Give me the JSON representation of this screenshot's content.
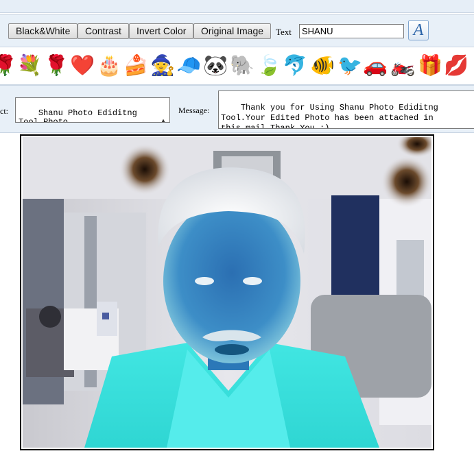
{
  "toolbar": {
    "black_white_label": "Black&White",
    "contrast_label": "Contrast",
    "invert_label": "Invert Color",
    "original_label": "Original Image",
    "text_label": "Text",
    "text_value": "SHANU",
    "font_button_glyph": "A"
  },
  "stickers": [
    {
      "name": "rose-icon",
      "glyph": "🌹"
    },
    {
      "name": "flower-bouquet-icon",
      "glyph": "💐"
    },
    {
      "name": "red-rose-icon",
      "glyph": "🌹"
    },
    {
      "name": "heart-icon",
      "glyph": "❤️"
    },
    {
      "name": "birthday-cake-icon",
      "glyph": "🎂"
    },
    {
      "name": "cake-icon",
      "glyph": "🍰"
    },
    {
      "name": "wizard-hat-icon",
      "glyph": "🧙"
    },
    {
      "name": "cap-icon",
      "glyph": "🧢"
    },
    {
      "name": "panda-icon",
      "glyph": "🐼"
    },
    {
      "name": "elephant-icon",
      "glyph": "🐘"
    },
    {
      "name": "leaf-icon",
      "glyph": "🍃"
    },
    {
      "name": "dolphin-icon",
      "glyph": "🐬"
    },
    {
      "name": "fish-icon",
      "glyph": "🐠"
    },
    {
      "name": "bird-icon",
      "glyph": "🐦"
    },
    {
      "name": "car-icon",
      "glyph": "🚗"
    },
    {
      "name": "motorbike-icon",
      "glyph": "🏍️"
    },
    {
      "name": "gift-icon",
      "glyph": "🎁"
    },
    {
      "name": "lips-icon",
      "glyph": "💋"
    }
  ],
  "mail": {
    "subject_label": "ct:",
    "subject_value": "Shanu Photo Ediditng\nTool Photo",
    "message_label": "Message:",
    "message_value": "Thank you for Using Shanu Photo Ediditng\nTool.Your Edited Photo has been attached in\nthis mail.Thank You :)"
  },
  "colors": {
    "toolbar_bg": "#e8f0f8",
    "photo_shirt": "#3fe6e0",
    "photo_skin": "#1f7fc1"
  }
}
